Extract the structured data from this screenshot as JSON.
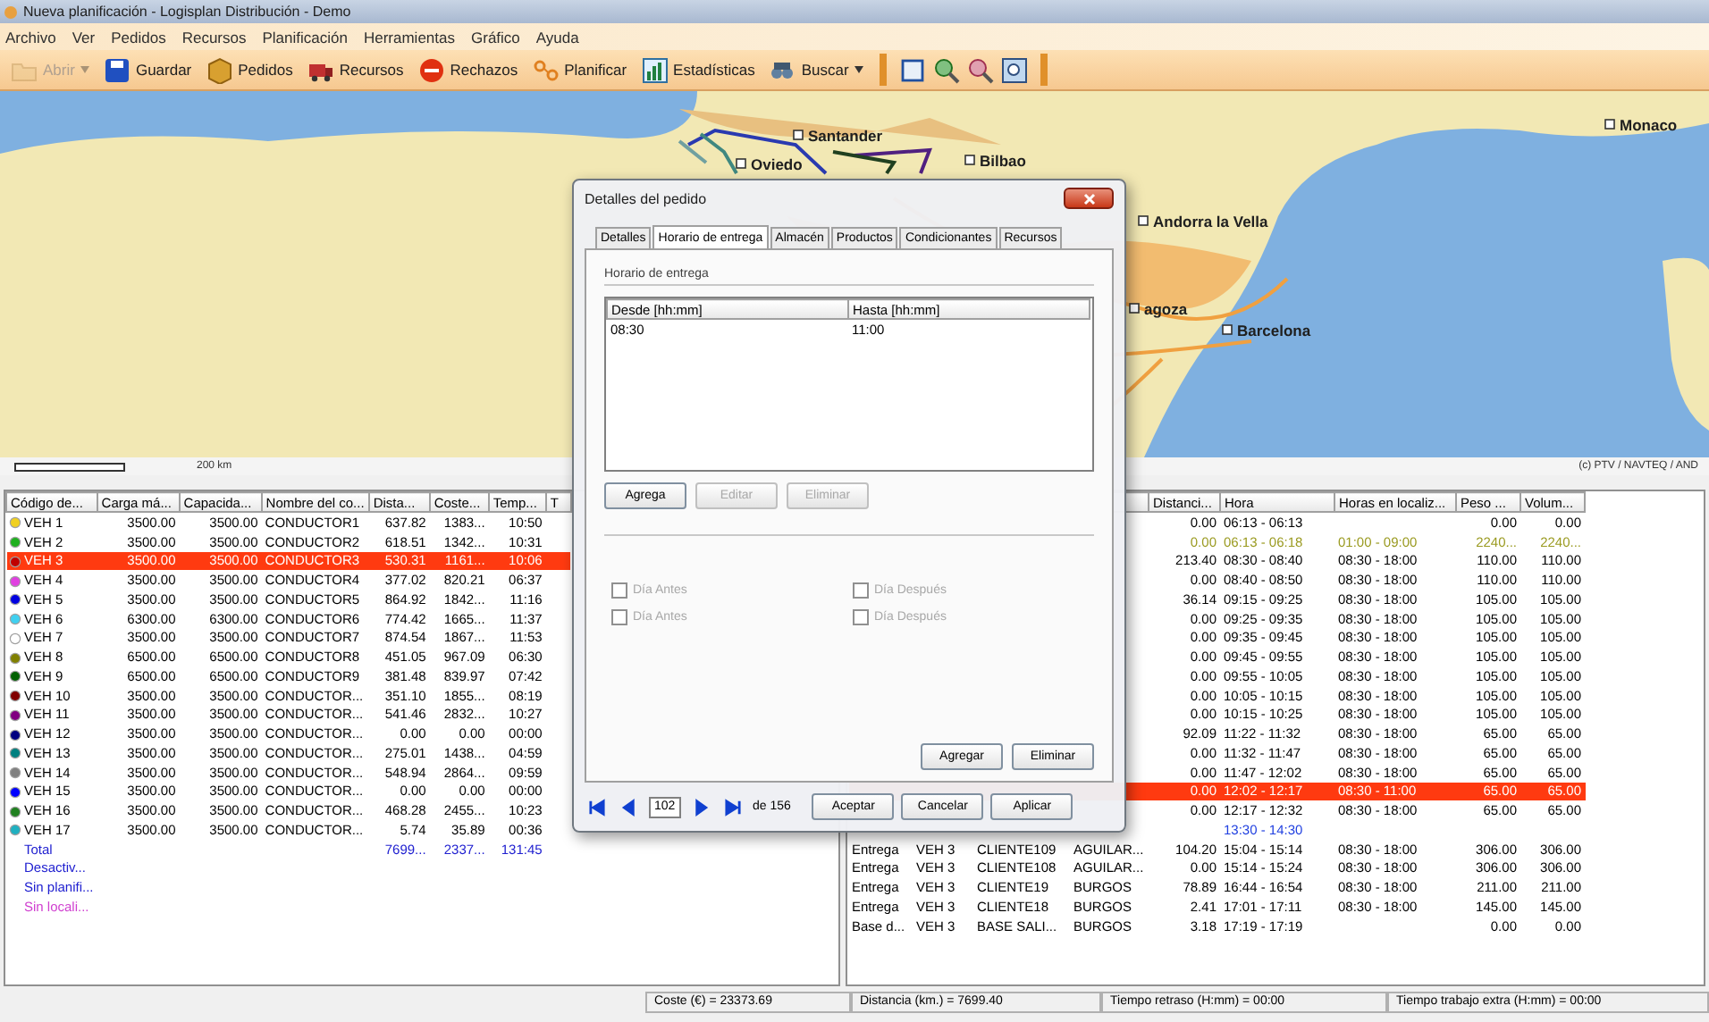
{
  "window": {
    "title": "Nueva planificación - Logisplan Distribución - Demo"
  },
  "menu": [
    "Archivo",
    "Ver",
    "Pedidos",
    "Recursos",
    "Planificación",
    "Herramientas",
    "Gráfico",
    "Ayuda"
  ],
  "toolbar": [
    {
      "label": "Abrir",
      "disabled": true,
      "dropdown": true
    },
    {
      "label": "Guardar",
      "disabled": false,
      "dropdown": false
    },
    {
      "label": "Pedidos",
      "disabled": false,
      "dropdown": false
    },
    {
      "label": "Recursos",
      "disabled": false,
      "dropdown": false
    },
    {
      "label": "Rechazos",
      "disabled": false,
      "dropdown": false
    },
    {
      "label": "Planificar",
      "disabled": false,
      "dropdown": false
    },
    {
      "label": "Estadísticas",
      "disabled": false,
      "dropdown": false
    },
    {
      "label": "Buscar",
      "disabled": false,
      "dropdown": true
    }
  ],
  "map": {
    "cities": [
      "Santander",
      "Oviedo",
      "Bilbao",
      "Andorra la Vella",
      "agoza",
      "Barcelona",
      "Monaco"
    ],
    "scale": "200 km",
    "copyright": "(c) PTV / NAVTEQ / AND"
  },
  "vehicles": {
    "columns": [
      "Código de...",
      "Carga má...",
      "Capacida...",
      "Nombre del co...",
      "Dista...",
      "Coste...",
      "Temp...",
      "T"
    ],
    "rows": [
      {
        "code": "VEH 1",
        "load": "3500.00",
        "capacity": "3500.00",
        "driver": "CONDUCTOR1",
        "distance": "637.82",
        "cost": "1383...",
        "time": "10:50",
        "color": "#f0d020",
        "selected": false
      },
      {
        "code": "VEH 2",
        "load": "3500.00",
        "capacity": "3500.00",
        "driver": "CONDUCTOR2",
        "distance": "618.51",
        "cost": "1342...",
        "time": "10:31",
        "color": "#20b020",
        "selected": false
      },
      {
        "code": "VEH 3",
        "load": "3500.00",
        "capacity": "3500.00",
        "driver": "CONDUCTOR3",
        "distance": "530.31",
        "cost": "1161...",
        "time": "10:06",
        "color": "#c00000",
        "selected": true
      },
      {
        "code": "VEH 4",
        "load": "3500.00",
        "capacity": "3500.00",
        "driver": "CONDUCTOR4",
        "distance": "377.02",
        "cost": "820.21",
        "time": "06:37",
        "color": "#e040e0",
        "selected": false
      },
      {
        "code": "VEH 5",
        "load": "3500.00",
        "capacity": "3500.00",
        "driver": "CONDUCTOR5",
        "distance": "864.92",
        "cost": "1842...",
        "time": "11:16",
        "color": "#0000e0",
        "selected": false
      },
      {
        "code": "VEH 6",
        "load": "6300.00",
        "capacity": "6300.00",
        "driver": "CONDUCTOR6",
        "distance": "774.42",
        "cost": "1665...",
        "time": "11:37",
        "color": "#40d0f0",
        "selected": false
      },
      {
        "code": "VEH 7",
        "load": "3500.00",
        "capacity": "3500.00",
        "driver": "CONDUCTOR7",
        "distance": "874.54",
        "cost": "1867...",
        "time": "11:53",
        "color": "#ffffff",
        "selected": false
      },
      {
        "code": "VEH 8",
        "load": "6500.00",
        "capacity": "6500.00",
        "driver": "CONDUCTOR8",
        "distance": "451.05",
        "cost": "967.09",
        "time": "06:30",
        "color": "#808000",
        "selected": false
      },
      {
        "code": "VEH 9",
        "load": "6500.00",
        "capacity": "6500.00",
        "driver": "CONDUCTOR9",
        "distance": "381.48",
        "cost": "839.97",
        "time": "07:42",
        "color": "#006000",
        "selected": false
      },
      {
        "code": "VEH 10",
        "load": "3500.00",
        "capacity": "3500.00",
        "driver": "CONDUCTOR...",
        "distance": "351.10",
        "cost": "1855...",
        "time": "08:19",
        "color": "#800000",
        "selected": false
      },
      {
        "code": "VEH 11",
        "load": "3500.00",
        "capacity": "3500.00",
        "driver": "CONDUCTOR...",
        "distance": "541.46",
        "cost": "2832...",
        "time": "10:27",
        "color": "#800080",
        "selected": false
      },
      {
        "code": "VEH 12",
        "load": "3500.00",
        "capacity": "3500.00",
        "driver": "CONDUCTOR...",
        "distance": "0.00",
        "cost": "0.00",
        "time": "00:00",
        "color": "#000080",
        "selected": false
      },
      {
        "code": "VEH 13",
        "load": "3500.00",
        "capacity": "3500.00",
        "driver": "CONDUCTOR...",
        "distance": "275.01",
        "cost": "1438...",
        "time": "04:59",
        "color": "#008080",
        "selected": false
      },
      {
        "code": "VEH 14",
        "load": "3500.00",
        "capacity": "3500.00",
        "driver": "CONDUCTOR...",
        "distance": "548.94",
        "cost": "2864...",
        "time": "09:59",
        "color": "#808080",
        "selected": false
      },
      {
        "code": "VEH 15",
        "load": "3500.00",
        "capacity": "3500.00",
        "driver": "CONDUCTOR...",
        "distance": "0.00",
        "cost": "0.00",
        "time": "00:00",
        "color": "#0000ff",
        "selected": false
      },
      {
        "code": "VEH 16",
        "load": "3500.00",
        "capacity": "3500.00",
        "driver": "CONDUCTOR...",
        "distance": "468.28",
        "cost": "2455...",
        "time": "10:23",
        "color": "#208020",
        "selected": false
      },
      {
        "code": "VEH 17",
        "load": "3500.00",
        "capacity": "3500.00",
        "driver": "CONDUCTOR...",
        "distance": "5.74",
        "cost": "35.89",
        "time": "00:36",
        "color": "#20b0c0",
        "selected": false
      }
    ],
    "summary": [
      {
        "label": "Total",
        "distance": "7699...",
        "cost": "2337...",
        "time": "131:45",
        "color": "#2020d0"
      },
      {
        "label": "Desactiv...",
        "color": "#2020d0"
      },
      {
        "label": "Sin planifi...",
        "color": "#2020d0"
      },
      {
        "label": "Sin locali...",
        "color": "#d040d0"
      }
    ]
  },
  "stops": {
    "columns": [
      "Distanci...",
      "Hora",
      "Horas en localiz...",
      "Peso ...",
      "Volum..."
    ],
    "rows": [
      {
        "kind": "stop",
        "selected": false,
        "distance": "0.00",
        "time": "06:13 - 06:13",
        "weight": "0.00",
        "volume": "0.00"
      },
      {
        "kind": "loading",
        "selected": false,
        "distance": "0.00",
        "time": "06:13 - 06:18",
        "window": "01:00 - 09:00",
        "weight": "2240...",
        "volume": "2240..."
      },
      {
        "kind": "stop",
        "selected": false,
        "distance": "213.40",
        "time": "08:30 - 08:40",
        "window": "08:30 - 18:00",
        "weight": "110.00",
        "volume": "110.00"
      },
      {
        "kind": "stop",
        "selected": false,
        "distance": "0.00",
        "time": "08:40 - 08:50",
        "window": "08:30 - 18:00",
        "weight": "110.00",
        "volume": "110.00"
      },
      {
        "kind": "stop",
        "selected": false,
        "distance": "36.14",
        "time": "09:15 - 09:25",
        "window": "08:30 - 18:00",
        "weight": "105.00",
        "volume": "105.00"
      },
      {
        "kind": "stop",
        "selected": false,
        "distance": "0.00",
        "time": "09:25 - 09:35",
        "window": "08:30 - 18:00",
        "weight": "105.00",
        "volume": "105.00"
      },
      {
        "kind": "stop",
        "selected": false,
        "distance": "0.00",
        "time": "09:35 - 09:45",
        "window": "08:30 - 18:00",
        "weight": "105.00",
        "volume": "105.00"
      },
      {
        "kind": "stop",
        "selected": false,
        "distance": "0.00",
        "time": "09:45 - 09:55",
        "window": "08:30 - 18:00",
        "weight": "105.00",
        "volume": "105.00"
      },
      {
        "kind": "stop",
        "selected": false,
        "distance": "0.00",
        "time": "09:55 - 10:05",
        "window": "08:30 - 18:00",
        "weight": "105.00",
        "volume": "105.00"
      },
      {
        "kind": "stop",
        "selected": false,
        "distance": "0.00",
        "time": "10:05 - 10:15",
        "window": "08:30 - 18:00",
        "weight": "105.00",
        "volume": "105.00"
      },
      {
        "kind": "stop",
        "selected": false,
        "distance": "0.00",
        "time": "10:15 - 10:25",
        "window": "08:30 - 18:00",
        "weight": "105.00",
        "volume": "105.00"
      },
      {
        "kind": "stop",
        "selected": false,
        "distance": "92.09",
        "time": "11:22 - 11:32",
        "window": "08:30 - 18:00",
        "weight": "65.00",
        "volume": "65.00"
      },
      {
        "kind": "stop",
        "selected": false,
        "distance": "0.00",
        "time": "11:32 - 11:47",
        "window": "08:30 - 18:00",
        "weight": "65.00",
        "volume": "65.00"
      },
      {
        "kind": "stop",
        "selected": false,
        "distance": "0.00",
        "time": "11:47 - 12:02",
        "window": "08:30 - 18:00",
        "weight": "65.00",
        "volume": "65.00"
      },
      {
        "kind": "stop",
        "selected": true,
        "distance": "0.00",
        "time": "12:02 - 12:17",
        "window": "08:30 - 11:00",
        "weight": "65.00",
        "volume": "65.00"
      },
      {
        "kind": "stop",
        "selected": false,
        "distance": "0.00",
        "time": "12:17 - 12:32",
        "window": "08:30 - 18:00",
        "weight": "65.00",
        "volume": "65.00"
      },
      {
        "kind": "pause",
        "selected": false,
        "time": "13:30 - 14:30"
      },
      {
        "kind": "stop",
        "selected": false,
        "type": "Entrega",
        "vehicle": "VEH 3",
        "client": "CLIENTE109",
        "city": "AGUILAR...",
        "distance": "104.20",
        "time": "15:04 - 15:14",
        "window": "08:30 - 18:00",
        "weight": "306.00",
        "volume": "306.00"
      },
      {
        "kind": "stop",
        "selected": false,
        "type": "Entrega",
        "vehicle": "VEH 3",
        "client": "CLIENTE108",
        "city": "AGUILAR...",
        "distance": "0.00",
        "time": "15:14 - 15:24",
        "window": "08:30 - 18:00",
        "weight": "306.00",
        "volume": "306.00"
      },
      {
        "kind": "stop",
        "selected": false,
        "type": "Entrega",
        "vehicle": "VEH 3",
        "client": "CLIENTE19",
        "city": "BURGOS",
        "distance": "78.89",
        "time": "16:44 - 16:54",
        "window": "08:30 - 18:00",
        "weight": "211.00",
        "volume": "211.00"
      },
      {
        "kind": "stop",
        "selected": false,
        "type": "Entrega",
        "vehicle": "VEH 3",
        "client": "CLIENTE18",
        "city": "BURGOS",
        "distance": "2.41",
        "time": "17:01 - 17:11",
        "window": "08:30 - 18:00",
        "weight": "145.00",
        "volume": "145.00"
      },
      {
        "kind": "stop",
        "selected": false,
        "type": "Base d...",
        "vehicle": "VEH 3",
        "client": "BASE SALI...",
        "city": "BURGOS",
        "distance": "3.18",
        "time": "17:19 - 17:19",
        "weight": "0.00",
        "volume": "0.00"
      }
    ]
  },
  "dialog": {
    "title": "Detalles del pedido",
    "tabs": [
      {
        "label": "Detalles",
        "selected": false
      },
      {
        "label": "Horario de entrega",
        "selected": true
      },
      {
        "label": "Almacén",
        "selected": false
      },
      {
        "label": "Productos",
        "selected": false
      },
      {
        "label": "Condicionantes",
        "selected": false
      },
      {
        "label": "Recursos",
        "selected": false
      }
    ],
    "group": "Horario de entrega",
    "schedule": {
      "columns": [
        "Desde [hh:mm]",
        "Hasta [hh:mm]"
      ],
      "rows": [
        [
          "08:30",
          "11:00"
        ]
      ]
    },
    "list_buttons": [
      {
        "label": "Agrega",
        "disabled": false
      },
      {
        "label": "Editar",
        "disabled": true
      },
      {
        "label": "Eliminar",
        "disabled": true
      }
    ],
    "checkboxes": [
      {
        "label": "Día Antes",
        "checked": false,
        "disabled": true
      },
      {
        "label": "Día Antes",
        "checked": false,
        "disabled": true
      },
      {
        "label": "Día Después",
        "checked": false,
        "disabled": true
      },
      {
        "label": "Día Después",
        "checked": false,
        "disabled": true
      }
    ],
    "item_buttons": [
      "Agregar",
      "Eliminar"
    ],
    "page": "102",
    "page_total": "de 156",
    "buttons": [
      "Aceptar",
      "Cancelar",
      "Aplicar"
    ]
  },
  "status_bar": [
    "Coste (€) = 23373.69",
    "Distancia (km.) = 7699.40",
    "Tiempo retraso (H:mm) = 00:00",
    "Tiempo trabajo extra (H:mm) = 00:00"
  ]
}
